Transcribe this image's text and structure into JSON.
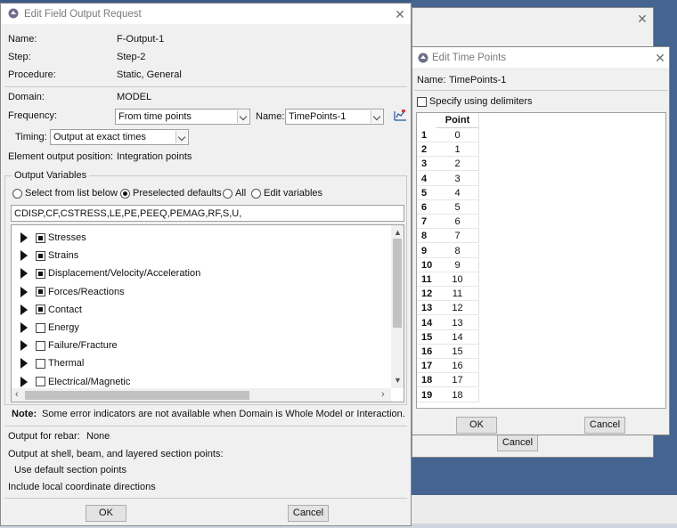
{
  "main_dialog": {
    "title": "Edit Field Output Request",
    "name_label": "Name:",
    "name_value": "F-Output-1",
    "step_label": "Step:",
    "step_value": "Step-2",
    "procedure_label": "Procedure:",
    "procedure_value": "Static, General",
    "domain_label": "Domain:",
    "domain_value": "MODEL",
    "frequency_label": "Frequency:",
    "frequency_value": "From time points",
    "name2_label": "Name:",
    "name2_value": "TimePoints-1",
    "timing_label": "Timing:",
    "timing_value": "Output at exact times",
    "element_pos_label": "Element output position:",
    "element_pos_value": "Integration points",
    "output_variables_label": "Output Variables",
    "radio_options": [
      "Select from list below",
      "Preselected defaults",
      "All",
      "Edit variables"
    ],
    "radio_selected": "Preselected defaults",
    "variables_text": "CDISP,CF,CSTRESS,LE,PE,PEEQ,PEMAG,RF,S,U,",
    "tree_items": [
      {
        "label": "Stresses",
        "checked": true
      },
      {
        "label": "Strains",
        "checked": true
      },
      {
        "label": "Displacement/Velocity/Acceleration",
        "checked": true
      },
      {
        "label": "Forces/Reactions",
        "checked": true
      },
      {
        "label": "Contact",
        "checked": true
      },
      {
        "label": "Energy",
        "checked": false
      },
      {
        "label": "Failure/Fracture",
        "checked": false
      },
      {
        "label": "Thermal",
        "checked": false
      },
      {
        "label": "Electrical/Magnetic",
        "checked": false
      }
    ],
    "note_label": "Note:",
    "note_text": "Some error indicators are not available when Domain is Whole Model or Interaction.",
    "rebar_label": "Output for rebar:",
    "rebar_value": "None",
    "section_points_label": "Output at shell, beam, and layered section points:",
    "section_points_value": "Use default section points",
    "local_coord_label": "Include local coordinate directions",
    "ok_label": "OK",
    "cancel_label": "Cancel"
  },
  "background_dialog": {
    "cancel_label": "Cancel"
  },
  "time_points_dialog": {
    "title": "Edit Time Points",
    "name_label": "Name:",
    "name_value": "TimePoints-1",
    "delimiters_label": "Specify using delimiters",
    "column_header": "Point",
    "row_numbers": [
      "1",
      "2",
      "3",
      "4",
      "5",
      "6",
      "7",
      "8",
      "9",
      "10",
      "11",
      "12",
      "13",
      "14",
      "15",
      "16",
      "17",
      "18",
      "19"
    ],
    "points": [
      "0",
      "1",
      "2",
      "3",
      "4",
      "5",
      "6",
      "7",
      "8",
      "9",
      "10",
      "11",
      "12",
      "13",
      "14",
      "15",
      "16",
      "17",
      "18"
    ],
    "ok_label": "OK",
    "cancel_label": "Cancel"
  },
  "colors": {
    "desktop": "#3a5b86",
    "dialog_bg": "#f0f0f0",
    "title_text": "#7a7a7a"
  }
}
